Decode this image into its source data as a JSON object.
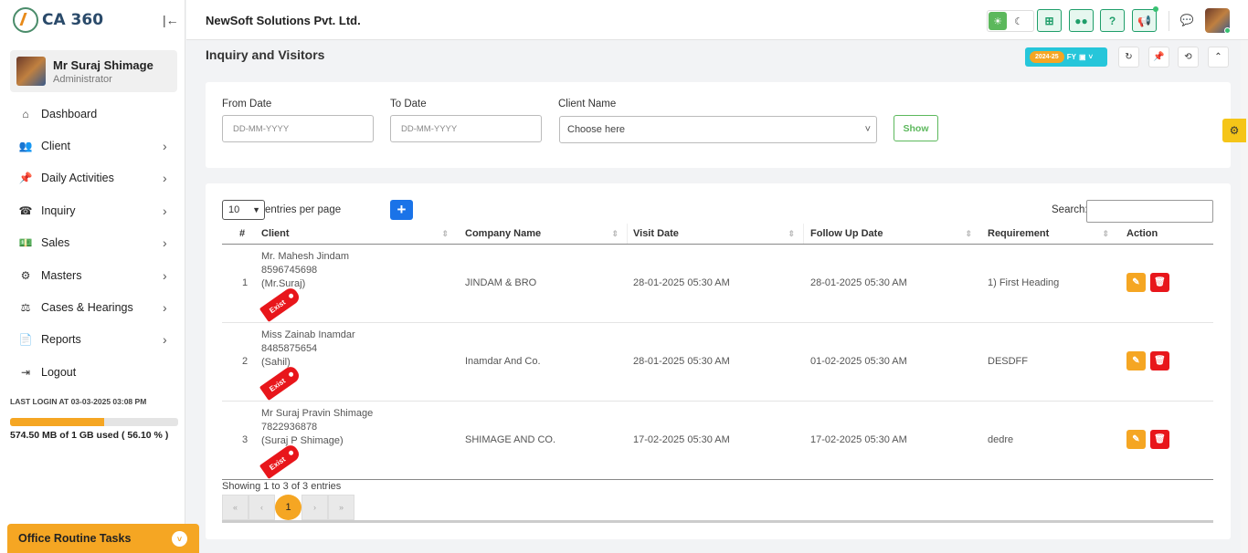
{
  "app": {
    "logo_text": "CA 360",
    "company": "NewSoft Solutions Pvt. Ltd."
  },
  "profile": {
    "name": "Mr Suraj Shimage",
    "role": "Administrator"
  },
  "sidebar": {
    "items": [
      {
        "label": "Dashboard",
        "icon": "home-icon",
        "glyph": "⌂",
        "has_children": false
      },
      {
        "label": "Client",
        "icon": "users-icon",
        "glyph": "👥",
        "has_children": true
      },
      {
        "label": "Daily Activities",
        "icon": "pin-icon",
        "glyph": "📌",
        "has_children": true
      },
      {
        "label": "Inquiry",
        "icon": "phone-icon",
        "glyph": "☎",
        "has_children": true
      },
      {
        "label": "Sales",
        "icon": "money-icon",
        "glyph": "💵",
        "has_children": true
      },
      {
        "label": "Masters",
        "icon": "cogs-icon",
        "glyph": "⚙",
        "has_children": true
      },
      {
        "label": "Cases & Hearings",
        "icon": "scale-icon",
        "glyph": "⚖",
        "has_children": true
      },
      {
        "label": "Reports",
        "icon": "file-icon",
        "glyph": "📄",
        "has_children": true
      },
      {
        "label": "Logout",
        "icon": "logout-icon",
        "glyph": "⇥",
        "has_children": false
      }
    ],
    "last_login": "LAST LOGIN AT 03-03-2025 03:08 PM",
    "storage_percent": 56.1,
    "storage_text": "574.50 MB of 1 GB used ( 56.10 % )",
    "routine_label": "Office Routine Tasks"
  },
  "header": {
    "title": "Inquiry and Visitors",
    "fy_year": "2024-25",
    "fy_label": "FY"
  },
  "filters": {
    "from_label": "From Date",
    "from_placeholder": "DD-MM-YYYY",
    "to_label": "To Date",
    "to_placeholder": "DD-MM-YYYY",
    "client_label": "Client Name",
    "client_value": "Choose here",
    "show_label": "Show"
  },
  "table": {
    "entries_value": "10",
    "entries_text": "entries per page",
    "search_label": "Search:",
    "columns": [
      "#",
      "Client",
      "Company Name",
      "Visit Date",
      "Follow Up Date",
      "Requirement",
      "Action"
    ],
    "rows": [
      {
        "num": "1",
        "client_name": "Mr. Mahesh Jindam",
        "phone": "8596745698",
        "ref": "(Mr.Suraj)",
        "tag": "Exist",
        "company": "JINDAM & BRO",
        "visit": "28-01-2025 05:30 AM",
        "follow": "28-01-2025 05:30 AM",
        "req": "1) First Heading"
      },
      {
        "num": "2",
        "client_name": "Miss Zainab Inamdar",
        "phone": "8485875654",
        "ref": "(Sahil)",
        "tag": "Exist",
        "company": "Inamdar And Co.",
        "visit": "28-01-2025 05:30 AM",
        "follow": "01-02-2025 05:30 AM",
        "req": "DESDFF"
      },
      {
        "num": "3",
        "client_name": "Mr Suraj Pravin Shimage",
        "phone": "7822936878",
        "ref": "(Suraj P Shimage)",
        "tag": "Exist",
        "company": "SHIMAGE AND CO.",
        "visit": "17-02-2025 05:30 AM",
        "follow": "17-02-2025 05:30 AM",
        "req": "dedre"
      }
    ],
    "showing": "Showing 1 to 3 of 3 entries",
    "pager": [
      "«",
      "‹",
      "1",
      "›",
      "»"
    ]
  },
  "colors": {
    "accent": "#f5a623",
    "danger": "#e8161b",
    "success": "#1f9e6a",
    "primary": "#1a73e8"
  }
}
